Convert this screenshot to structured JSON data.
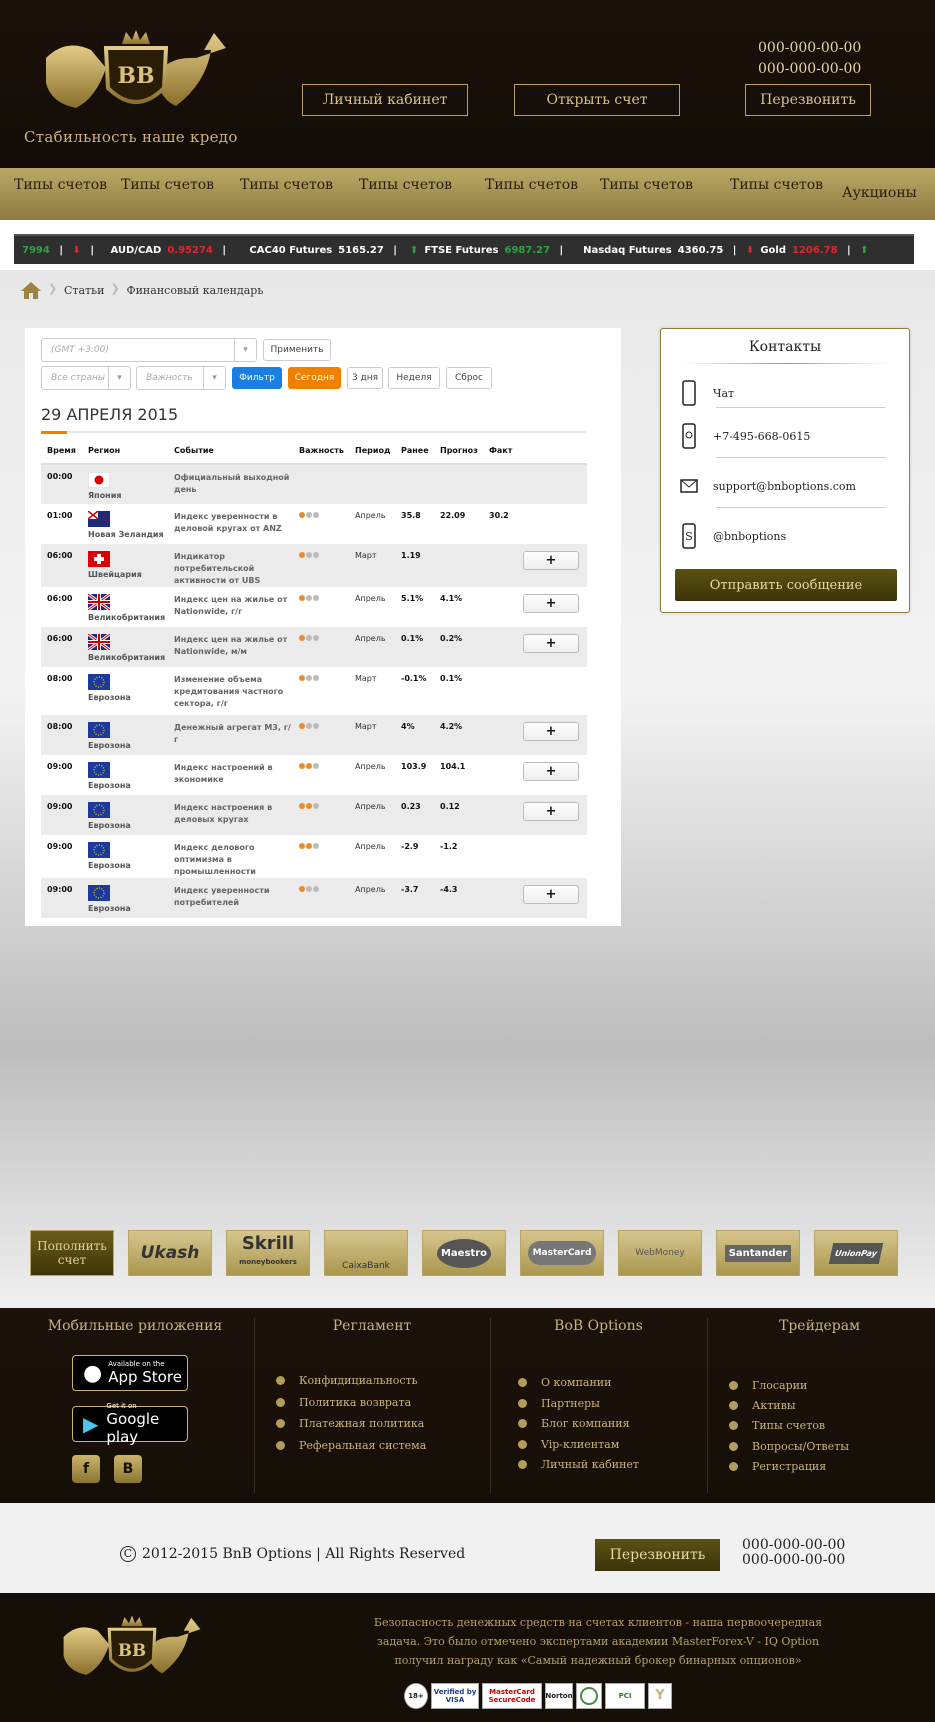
{
  "header": {
    "tagline": "Стабильность наше кредо",
    "cabinet_btn": "Личный кабинет",
    "open_btn": "Открыть счет",
    "callback_btn": "Перезвонить",
    "phone1": "000-000-00-00",
    "phone2": "000-000-00-00"
  },
  "nav": [
    "Типы счетов",
    "Типы счетов",
    "Типы счетов",
    "Типы счетов",
    "Типы счетов",
    "Типы счетов",
    "Типы счетов",
    "Аукционы"
  ],
  "ticker": [
    {
      "name": "",
      "value": "7994",
      "dir": "up"
    },
    {
      "name": "AUD/CAD",
      "value": "0.95274",
      "dir": "dn"
    },
    {
      "name": "CAC40 Futures",
      "value": "5165.27",
      "dir": "up"
    },
    {
      "name": "FTSE Futures",
      "value": "6987.27",
      "dir": "dn"
    },
    {
      "name": "Nasdaq Futures",
      "value": "4360.75",
      "dir": "dn"
    },
    {
      "name": "Gold",
      "value": "1206.78",
      "dir": "up"
    }
  ],
  "breadcrumb": {
    "item1": "Статьи",
    "item2": "Финансовый календарь"
  },
  "calendar": {
    "timezone_placeholder": "(GMT +3:00)",
    "apply": "Применить",
    "country_placeholder": "Все страны",
    "importance_placeholder": "Важность",
    "filter": "Фильтр",
    "today": "Сегодня",
    "three_days": "3 дня",
    "week": "Неделя",
    "reset": "Сброс",
    "date": "29 АПРЕЛЯ 2015",
    "columns": [
      "Время",
      "Регион",
      "Событие",
      "Важность",
      "Период",
      "Ранее",
      "Прогноз",
      "Факт"
    ],
    "rows": [
      {
        "time": "00:00",
        "flag": "jp",
        "region": "Япония",
        "event": "Официальный выходной день",
        "imp": 0,
        "period": "",
        "prev": "",
        "fore": "",
        "fact": "",
        "plus": false
      },
      {
        "time": "01:00",
        "flag": "nz",
        "region": "Новая Зеландия",
        "event": "Индекс уверенности в деловой кругах от ANZ",
        "imp": 1,
        "period": "Апрель",
        "prev": "35.8",
        "fore": "22.09",
        "fact": "30.2",
        "plus": false
      },
      {
        "time": "06:00",
        "flag": "ch",
        "region": "Швейцария",
        "event": "Индикатор потребительской активности от UBS",
        "imp": 1,
        "period": "Март",
        "prev": "1.19",
        "fore": "",
        "fact": "",
        "plus": true
      },
      {
        "time": "06:00",
        "flag": "gb",
        "region": "Великобритания",
        "event": "Индекс цен на жилье от Nationwide, г/г",
        "imp": 1,
        "period": "Апрель",
        "prev": "5.1%",
        "fore": "4.1%",
        "fact": "",
        "plus": true
      },
      {
        "time": "06:00",
        "flag": "gb",
        "region": "Великобритания",
        "event": "Индекс цен на жилье от Nationwide, м/м",
        "imp": 1,
        "period": "Апрель",
        "prev": "0.1%",
        "fore": "0.2%",
        "fact": "",
        "plus": true
      },
      {
        "time": "08:00",
        "flag": "eu",
        "region": "Еврозона",
        "event": "Изменение объема кредитования частного сектора, г/г",
        "imp": 1,
        "period": "Март",
        "prev": "-0.1%",
        "fore": "0.1%",
        "fact": "",
        "plus": false
      },
      {
        "time": "08:00",
        "flag": "eu",
        "region": "Еврозона",
        "event": "Денежный агрегат М3, г/г",
        "imp": 1,
        "period": "Март",
        "prev": "4%",
        "fore": "4.2%",
        "fact": "",
        "plus": true
      },
      {
        "time": "09:00",
        "flag": "eu",
        "region": "Еврозона",
        "event": "Индекс настроений в экономике",
        "imp": 2,
        "period": "Апрель",
        "prev": "103.9",
        "fore": "104.1",
        "fact": "",
        "plus": true
      },
      {
        "time": "09:00",
        "flag": "eu",
        "region": "Еврозона",
        "event": "Индекс настроения в деловых кругах",
        "imp": 2,
        "period": "Апрель",
        "prev": "0.23",
        "fore": "0.12",
        "fact": "",
        "plus": true
      },
      {
        "time": "09:00",
        "flag": "eu",
        "region": "Еврозона",
        "event": "Индекс делового оптимизма в промышленности",
        "imp": 2,
        "period": "Апрель",
        "prev": "-2.9",
        "fore": "-1.2",
        "fact": "",
        "plus": false
      },
      {
        "time": "09:00",
        "flag": "eu",
        "region": "Еврозона",
        "event": "Индекс уверенности потребителей",
        "imp": 1,
        "period": "Апрель",
        "prev": "-3.7",
        "fore": "-4.3",
        "fact": "",
        "plus": true
      }
    ],
    "plus_label": "+"
  },
  "contacts": {
    "title": "Контакты",
    "chat": "Чат",
    "phone": "+7-495-668-0615",
    "email": "support@bnboptions.com",
    "skype": "@bnboptions",
    "send": "Отправить сообщение"
  },
  "payments": {
    "deposit": "Пополнить счет",
    "ukash": "Ukash",
    "skrill": "Skrill",
    "skrill_sub": "moneybookers",
    "caixa": "CaixaBank",
    "maestro": "Maestro",
    "mastercard": "MasterCard",
    "webmoney": "WebMoney",
    "santander": "Santander",
    "unionpay": "UnionPay"
  },
  "footer": {
    "col1": "Мобильные риложения",
    "col2": "Регламент",
    "col3": "BoB Options",
    "col4": "Трейдерам",
    "appstore_small": "Available on the",
    "appstore": "App Store",
    "gplay_small": "Get it on",
    "gplay": "Google play",
    "fb": "f",
    "vk": "B",
    "reg": [
      "Конфидициальность",
      "Политика возврата",
      "Платежная политика",
      "Реферальная система"
    ],
    "bob": [
      "О компании",
      "Партнеры",
      "Блог компания",
      "Vip-клиентам",
      "Личный кабинет"
    ],
    "tr": [
      "Глосарии",
      "Активы",
      "Типы счетов",
      "Вопросы/Ответы",
      "Регистрация"
    ]
  },
  "copyright": {
    "text": "2012-2015 BnB Options | All Rights Reserved",
    "callback": "Перезвонить",
    "phone1": "000-000-00-00",
    "phone2": "000-000-00-00"
  },
  "bottom": {
    "l1": "Безопасность денежных средств на счетах клиентов - наша первоочередная",
    "l2": "задача. Это было отмечено экспертами академии MasterForex-V - IQ Option",
    "l3": "получил награду как «Самый надежный брокер бинарных опционов»",
    "badges": [
      "18+",
      "Verified by VISA",
      "MasterCard SecureCode",
      "Norton",
      "",
      "PCI",
      "Y"
    ]
  },
  "colors": {
    "gold": "#c9b27a",
    "dark": "#1b120a",
    "orange": "#f08000",
    "blue": "#1a7fe0"
  }
}
